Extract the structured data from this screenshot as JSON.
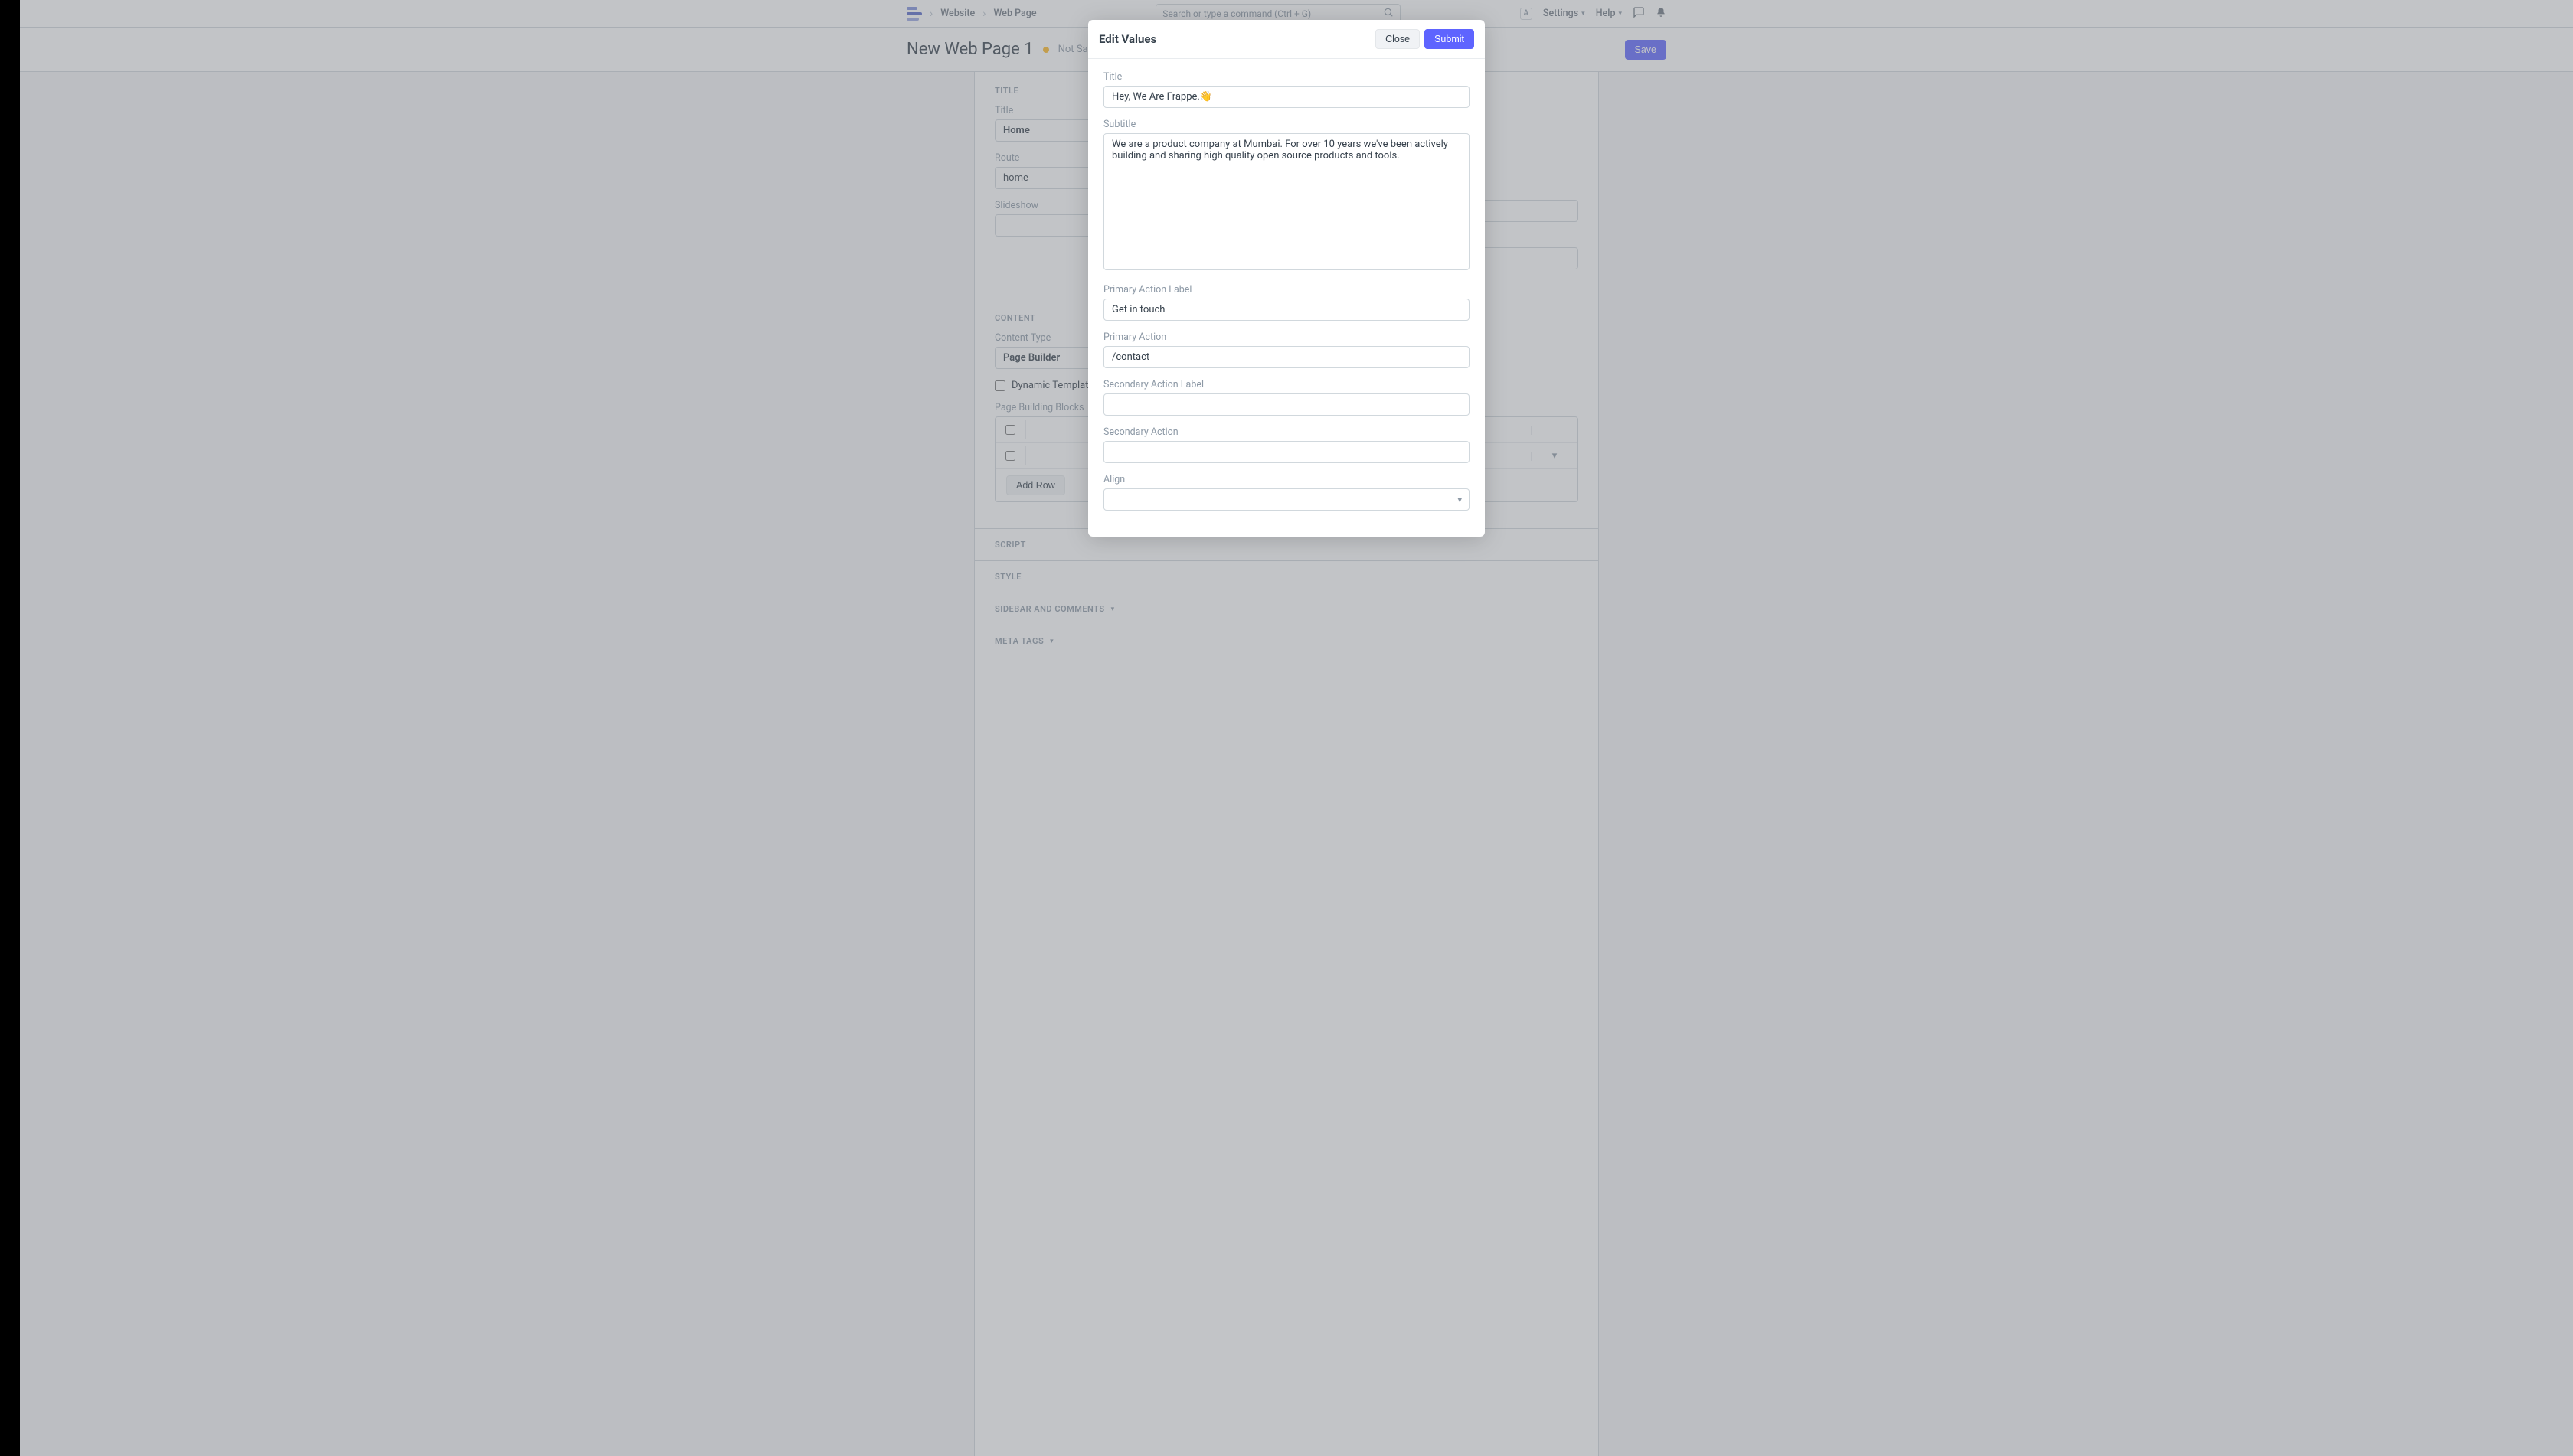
{
  "topbar": {
    "breadcrumbs": [
      "Website",
      "Web Page"
    ],
    "search_placeholder": "Search or type a command (Ctrl + G)",
    "avatar_initial": "A",
    "settings_label": "Settings",
    "help_label": "Help"
  },
  "page_header": {
    "title": "New Web Page 1",
    "status": "Not Saved",
    "save_label": "Save"
  },
  "form": {
    "section_title_title": "TITLE",
    "title_label": "Title",
    "title_value": "Home",
    "route_label": "Route",
    "route_value": "home",
    "slideshow_label": "Slideshow",
    "section_content": "CONTENT",
    "content_type_label": "Content Type",
    "content_type_value": "Page Builder",
    "dynamic_template_label": "Dynamic Template",
    "page_blocks_label": "Page Building Blocks",
    "add_row_label": "Add Row",
    "section_script": "SCRIPT",
    "section_style": "STYLE",
    "section_sidebar": "SIDEBAR AND COMMENTS",
    "section_meta": "META TAGS"
  },
  "modal": {
    "title": "Edit Values",
    "close_label": "Close",
    "submit_label": "Submit",
    "fields": {
      "title_label": "Title",
      "title_value": "Hey, We Are Frappe.👋",
      "subtitle_label": "Subtitle",
      "subtitle_value": "We are a product company at Mumbai. For over 10 years we've been actively building and sharing high quality open source products and tools.",
      "primary_action_label_label": "Primary Action Label",
      "primary_action_label_value": "Get in touch",
      "primary_action_label": "Primary Action",
      "primary_action_value": "/contact",
      "secondary_action_label_label": "Secondary Action Label",
      "secondary_action_label_value": "",
      "secondary_action_label2": "Secondary Action",
      "secondary_action_value": "",
      "align_label": "Align",
      "align_value": ""
    }
  }
}
